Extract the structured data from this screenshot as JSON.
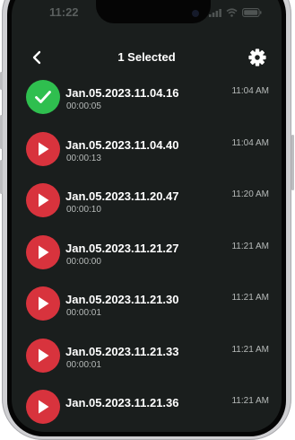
{
  "colors": {
    "background": "#1a1e1d",
    "selected": "#2fbf4f",
    "play": "#d8333d",
    "text_primary": "#ffffff",
    "text_secondary": "#b7bbba"
  },
  "status_bar": {
    "time": "11:22"
  },
  "header": {
    "back_icon": "chevron-left-icon",
    "title": "1 Selected",
    "settings_icon": "gear-icon"
  },
  "recordings": [
    {
      "name": "Jan.05.2023.11.04.16",
      "duration": "00:00:05",
      "time": "11:04 AM",
      "selected": true
    },
    {
      "name": "Jan.05.2023.11.04.40",
      "duration": "00:00:13",
      "time": "11:04 AM",
      "selected": false
    },
    {
      "name": "Jan.05.2023.11.20.47",
      "duration": "00:00:10",
      "time": "11:20 AM",
      "selected": false
    },
    {
      "name": "Jan.05.2023.11.21.27",
      "duration": "00:00:00",
      "time": "11:21 AM",
      "selected": false
    },
    {
      "name": "Jan.05.2023.11.21.30",
      "duration": "00:00:01",
      "time": "11:21 AM",
      "selected": false
    },
    {
      "name": "Jan.05.2023.11.21.33",
      "duration": "00:00:01",
      "time": "11:21 AM",
      "selected": false
    },
    {
      "name": "Jan.05.2023.11.21.36",
      "duration": "",
      "time": "11:21 AM",
      "selected": false
    }
  ]
}
